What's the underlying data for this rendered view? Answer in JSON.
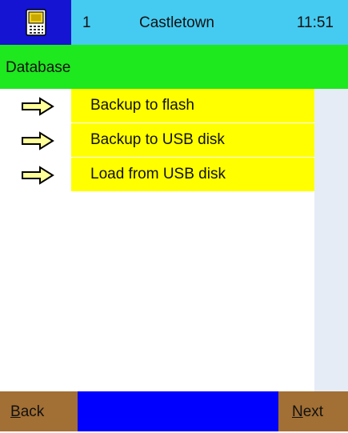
{
  "header": {
    "number": "1",
    "location": "Castletown",
    "time": "11:51",
    "logo_icon": "handheld-device-icon"
  },
  "title": "Database",
  "menu": {
    "arrow_icon": "right-arrow-icon",
    "items": [
      {
        "label": "Backup to flash"
      },
      {
        "label": "Backup to USB disk"
      },
      {
        "label": "Load from USB disk"
      }
    ]
  },
  "footer": {
    "back": {
      "first": "B",
      "rest": "ack"
    },
    "next": {
      "first": "N",
      "rest": "ext"
    }
  },
  "colors": {
    "header_bg": "#45cbf1",
    "logo_bg": "#1414d2",
    "title_bg": "#1ee81e",
    "item_bg": "#ffff00",
    "arrow_fill": "#ffff99",
    "side_panel": "#e6ecf6",
    "footer_bg": "#0000ff",
    "nav_button_bg": "#a26f34"
  }
}
